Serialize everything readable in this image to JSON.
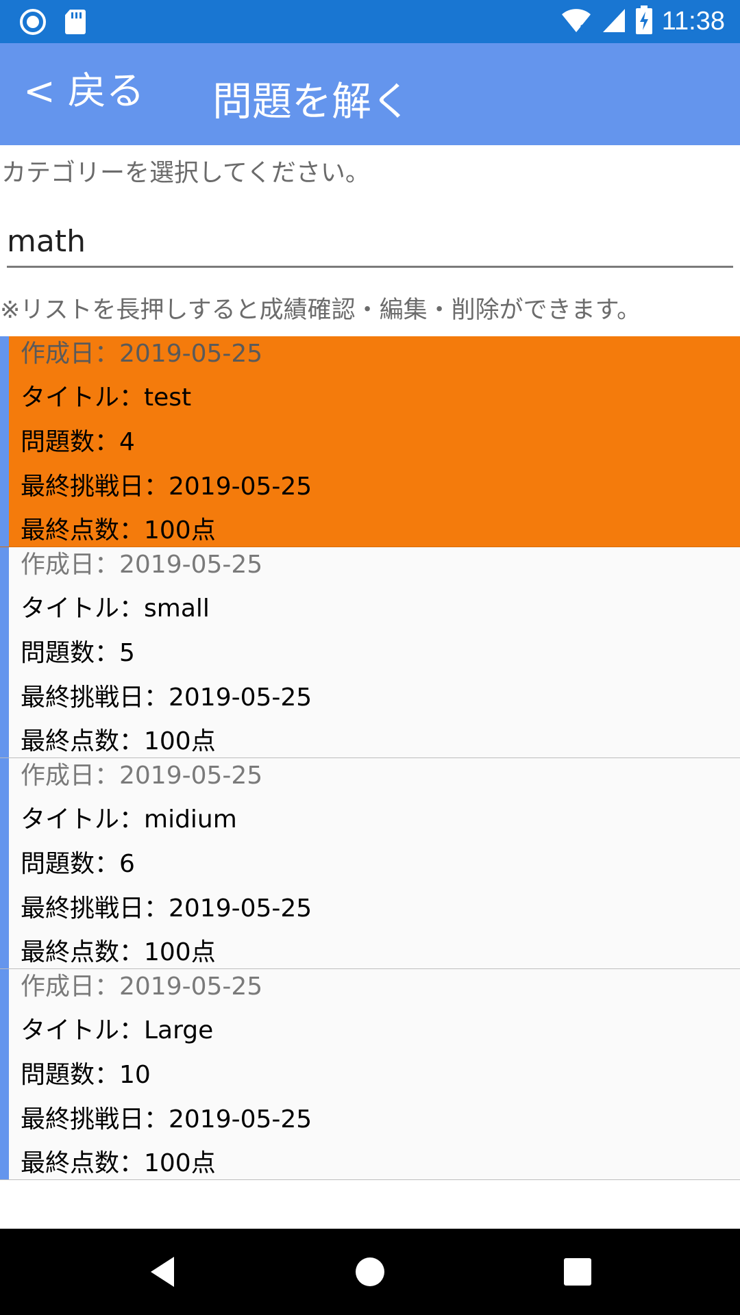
{
  "status_bar": {
    "time": "11:38",
    "left_icons": [
      "record-icon",
      "sd-card-icon"
    ],
    "right_icons": [
      "wifi-icon",
      "signal-icon",
      "battery-charging-icon"
    ]
  },
  "header": {
    "back_label": "< 戻る",
    "title": "問題を解く"
  },
  "category": {
    "prompt": "カテゴリーを選択してください。",
    "selected_value": "math"
  },
  "hint": "※リストを長押しすると成績確認・編集・削除ができます。",
  "quizzes": [
    {
      "created": "作成日：2019-05-25",
      "title": "タイトル：test",
      "count": "問題数：4",
      "last_attempt": "最終挑戦日：2019-05-25",
      "last_score": "最終点数：100点",
      "selected": true
    },
    {
      "created": "作成日：2019-05-25",
      "title": "タイトル：small",
      "count": "問題数：5",
      "last_attempt": "最終挑戦日：2019-05-25",
      "last_score": "最終点数：100点",
      "selected": false
    },
    {
      "created": "作成日：2019-05-25",
      "title": "タイトル：midium",
      "count": "問題数：6",
      "last_attempt": "最終挑戦日：2019-05-25",
      "last_score": "最終点数：100点",
      "selected": false
    },
    {
      "created": "作成日：2019-05-25",
      "title": "タイトル：Large",
      "count": "問題数：10",
      "last_attempt": "最終挑戦日：2019-05-25",
      "last_score": "最終点数：100点",
      "selected": false
    }
  ],
  "colors": {
    "status_bar": "#1976d2",
    "app_bar": "#6495ed",
    "selected_item": "#f47b0c",
    "accent": "#6495ed"
  },
  "nav_bar": {
    "icons": [
      "nav-back-icon",
      "nav-home-icon",
      "nav-recent-icon"
    ]
  }
}
